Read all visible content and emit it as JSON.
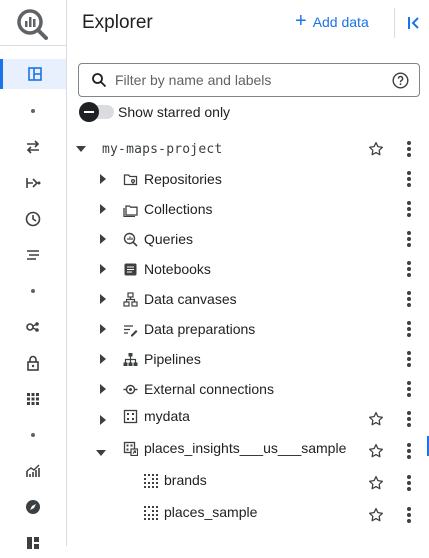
{
  "header": {
    "title": "Explorer",
    "add_data_label": "Add data"
  },
  "search": {
    "placeholder": "Filter by name and labels"
  },
  "starred_toggle": {
    "label": "Show starred only",
    "on": false
  },
  "project": {
    "name": "my-maps-project"
  },
  "tree": [
    {
      "label": "Repositories",
      "icon": "repository-icon",
      "expanded": false,
      "starrable": false
    },
    {
      "label": "Collections",
      "icon": "collections-icon",
      "expanded": false,
      "starrable": false
    },
    {
      "label": "Queries",
      "icon": "queries-icon",
      "expanded": false,
      "starrable": false
    },
    {
      "label": "Notebooks",
      "icon": "notebook-icon",
      "expanded": false,
      "starrable": false
    },
    {
      "label": "Data canvases",
      "icon": "data-canvas-icon",
      "expanded": false,
      "starrable": false
    },
    {
      "label": "Data preparations",
      "icon": "data-preparation-icon",
      "expanded": false,
      "starrable": false
    },
    {
      "label": "Pipelines",
      "icon": "pipelines-icon",
      "expanded": false,
      "starrable": false
    },
    {
      "label": "External connections",
      "icon": "external-connection-icon",
      "expanded": false,
      "starrable": false
    },
    {
      "label": "mydata",
      "icon": "dataset-icon",
      "expanded": false,
      "starrable": true
    },
    {
      "label": "places_insights___us___sample",
      "icon": "linked-dataset-icon",
      "expanded": true,
      "starrable": true
    },
    {
      "label": "brands",
      "icon": "table-icon",
      "starrable": true
    },
    {
      "label": "places_sample",
      "icon": "table-icon",
      "starrable": true
    }
  ],
  "colors": {
    "accent": "#1a73e8",
    "text": "#202124",
    "icon": "#5f6368",
    "active_rail_bg": "#e8f0fe"
  }
}
